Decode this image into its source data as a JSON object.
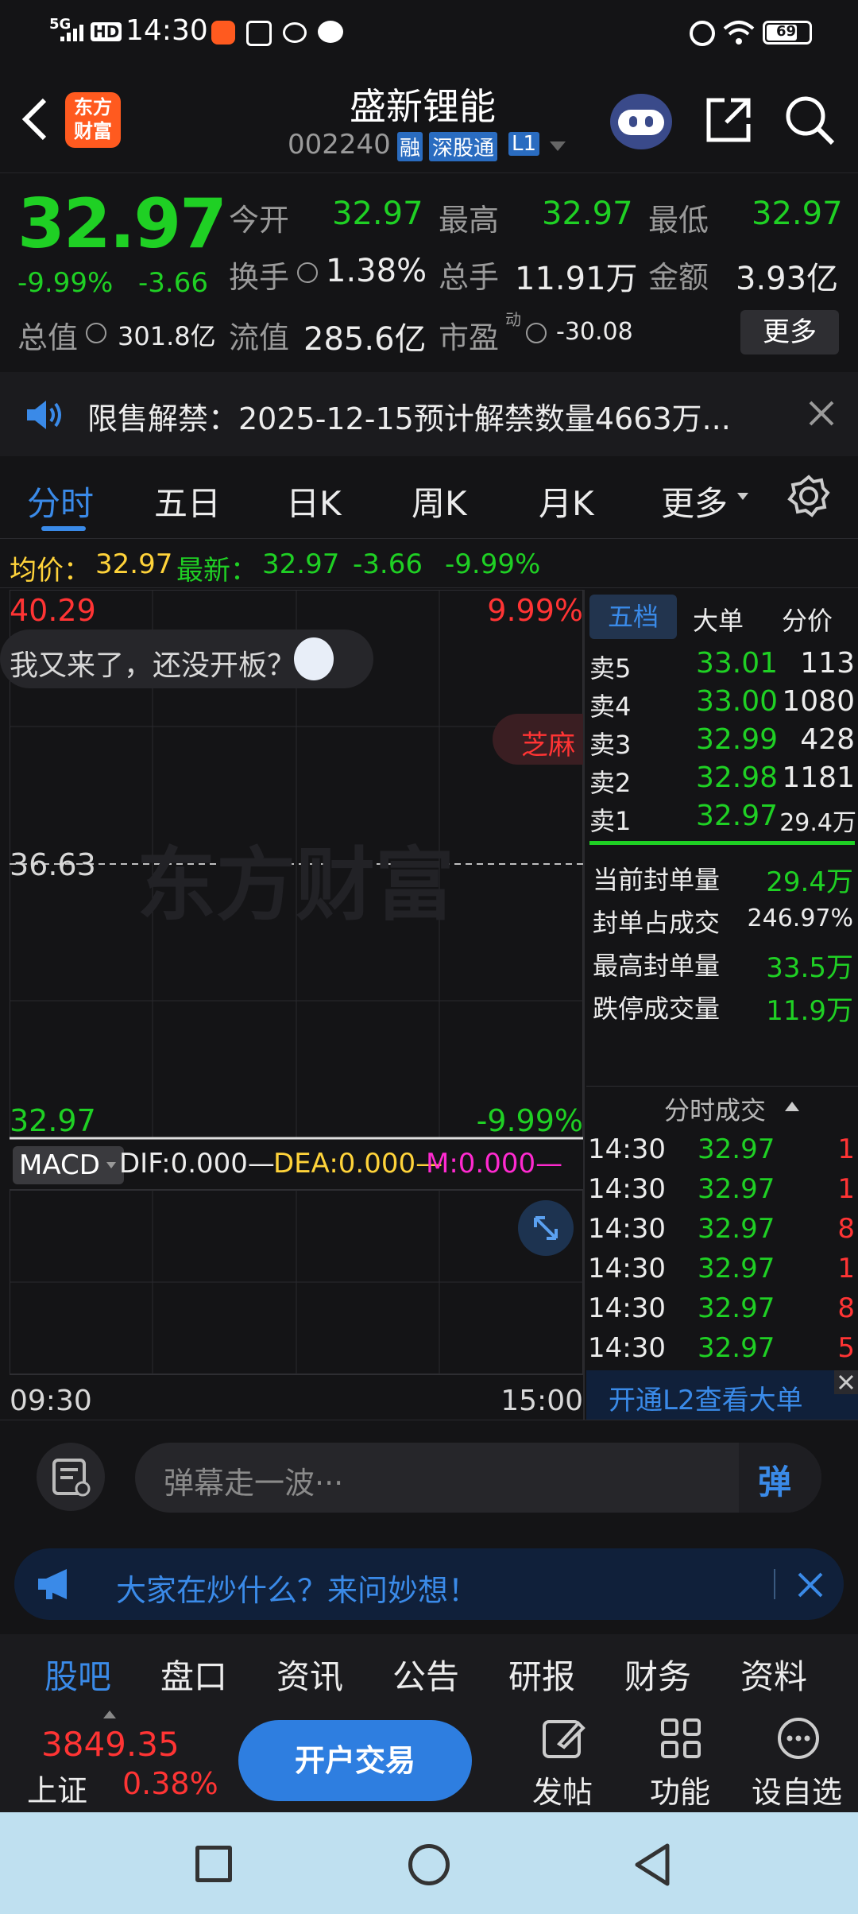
{
  "status": {
    "network": "5G",
    "hd": "HD",
    "time": "14:30",
    "battery": "69"
  },
  "header": {
    "logo": "东方\n财富",
    "title": "盛新锂能",
    "code": "002240",
    "tag_rong": "融",
    "tag_sgt": "深股通",
    "tag_l1": "L1"
  },
  "quote": {
    "price": "32.97",
    "change_pct": "-9.99%",
    "change": "-3.66",
    "open_label": "今开",
    "open": "32.97",
    "high_label": "最高",
    "high": "32.97",
    "low_label": "最低",
    "low": "32.97",
    "turnover_label": "换手",
    "turnover": "1.38%",
    "volume_label": "总手",
    "volume": "11.91万",
    "amount_label": "金额",
    "amount": "3.93亿",
    "mktcap_label": "总值",
    "mktcap": "301.8亿",
    "float_label": "流值",
    "float": "285.6亿",
    "pe_label": "市盈",
    "pe_sup": "动",
    "pe": "-30.08",
    "more": "更多"
  },
  "notice": {
    "text": "限售解禁：2025-12-15预计解禁数量4663万..."
  },
  "tabs": [
    "分时",
    "五日",
    "日K",
    "周K",
    "月K",
    "更多"
  ],
  "avg": {
    "avg_label": "均价：",
    "avg": "32.97",
    "latest_label": "最新：",
    "latest": "32.97",
    "chg": "-3.66",
    "pct": "-9.99%"
  },
  "chart": {
    "top_price": "40.29",
    "top_pct": "9.99%",
    "mid_price": "36.63",
    "bot_price": "32.97",
    "bot_pct": "-9.99%",
    "watermark": "东方财富",
    "bubble": "我又来了，还没开板？",
    "bubble2": "芝麻",
    "macd_label": "MACD",
    "dif": "DIF:0.000—",
    "dea": "DEA:0.000—",
    "m": "M:0.000—",
    "time_start": "09:30",
    "time_end": "15:00"
  },
  "orderbook": {
    "tabs": [
      "五档",
      "大单",
      "分价"
    ],
    "asks": [
      {
        "label": "卖5",
        "price": "33.01",
        "vol": "113"
      },
      {
        "label": "卖4",
        "price": "33.00",
        "vol": "1080"
      },
      {
        "label": "卖3",
        "price": "32.99",
        "vol": "428"
      },
      {
        "label": "卖2",
        "price": "32.98",
        "vol": "1181"
      },
      {
        "label": "卖1",
        "price": "32.97",
        "vol": "29.4万"
      }
    ],
    "stats": [
      {
        "label": "当前封单量",
        "value": "29.4万"
      },
      {
        "label": "封单占成交",
        "value": "246.97%"
      },
      {
        "label": "最高封单量",
        "value": "33.5万"
      },
      {
        "label": "跌停成交量",
        "value": "11.9万"
      }
    ],
    "ticks_title": "分时成交",
    "ticks": [
      {
        "time": "14:30",
        "price": "32.97",
        "vol": "1"
      },
      {
        "time": "14:30",
        "price": "32.97",
        "vol": "1"
      },
      {
        "time": "14:30",
        "price": "32.97",
        "vol": "8"
      },
      {
        "time": "14:30",
        "price": "32.97",
        "vol": "1"
      },
      {
        "time": "14:30",
        "price": "32.97",
        "vol": "8"
      },
      {
        "time": "14:30",
        "price": "32.97",
        "vol": "5"
      }
    ],
    "l2": "开通L2查看大单"
  },
  "danmu": {
    "placeholder": "弹幕走一波···",
    "btn": "弹"
  },
  "ask": {
    "text": "大家在炒什么？来问妙想！"
  },
  "subtabs": [
    "股吧",
    "盘口",
    "资讯",
    "公告",
    "研报",
    "财务",
    "资料"
  ],
  "bottom": {
    "index_value": "3849.35",
    "index_name": "上证",
    "index_pct": "0.38%",
    "trade": "开户交易",
    "post": "发帖",
    "func": "功能",
    "watch": "设自选"
  }
}
